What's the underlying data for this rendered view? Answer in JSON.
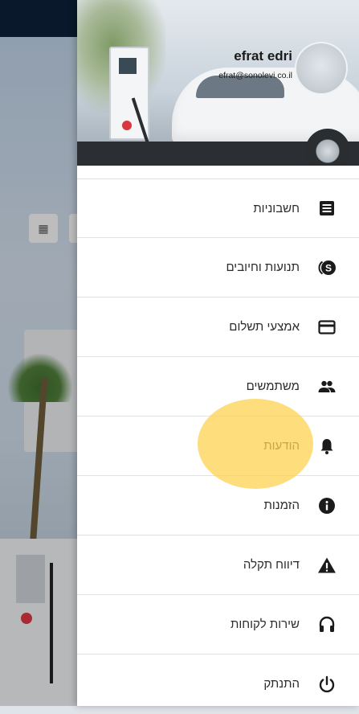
{
  "drawer": {
    "user": {
      "name": "efrat edri",
      "email": "efrat@sonolevi.co.il"
    },
    "menu": [
      {
        "label": "חשבוניות",
        "icon": "receipt-icon"
      },
      {
        "label": "תנועות וחיובים",
        "icon": "coin-s-icon"
      },
      {
        "label": "אמצעי תשלום",
        "icon": "credit-card-icon"
      },
      {
        "label": "משתמשים",
        "icon": "people-icon"
      },
      {
        "label": "הודעות",
        "icon": "bell-icon"
      },
      {
        "label": "הזמנות",
        "icon": "info-icon"
      },
      {
        "label": "דיווח תקלה",
        "icon": "warning-icon"
      },
      {
        "label": "שירות לקוחות",
        "icon": "headset-icon"
      },
      {
        "label": "התנתק",
        "icon": "power-icon"
      }
    ],
    "highlighted_item": "הודעות"
  },
  "colors": {
    "top_bar": "#0c1f38",
    "highlight": "#fcd250",
    "icon": "#1b1b1b"
  }
}
